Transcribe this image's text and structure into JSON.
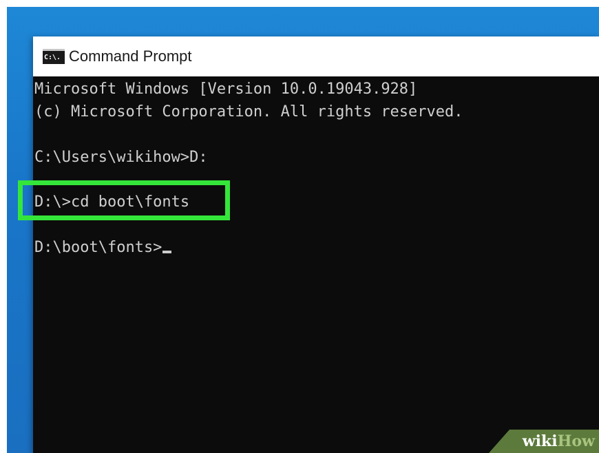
{
  "window": {
    "title": "Command Prompt",
    "icon": "cmd-app-icon",
    "icon_text": "C:\\."
  },
  "console": {
    "lines": [
      "Microsoft Windows [Version 10.0.19043.928]",
      "(c) Microsoft Corporation. All rights reserved.",
      "C:\\Users\\wikihow>D:",
      "D:\\>cd boot\\fonts",
      "D:\\boot\\fonts>"
    ],
    "highlighted_line": "D:\\>cd boot\\fonts"
  },
  "watermark": {
    "wiki": "wiki",
    "how": "How"
  },
  "colors": {
    "desktop_blue": "#1a78c9",
    "console_bg": "#0c0c0c",
    "console_text": "#cccccc",
    "highlight_green": "#35e63a",
    "watermark_bg": "#5c7a3c"
  }
}
